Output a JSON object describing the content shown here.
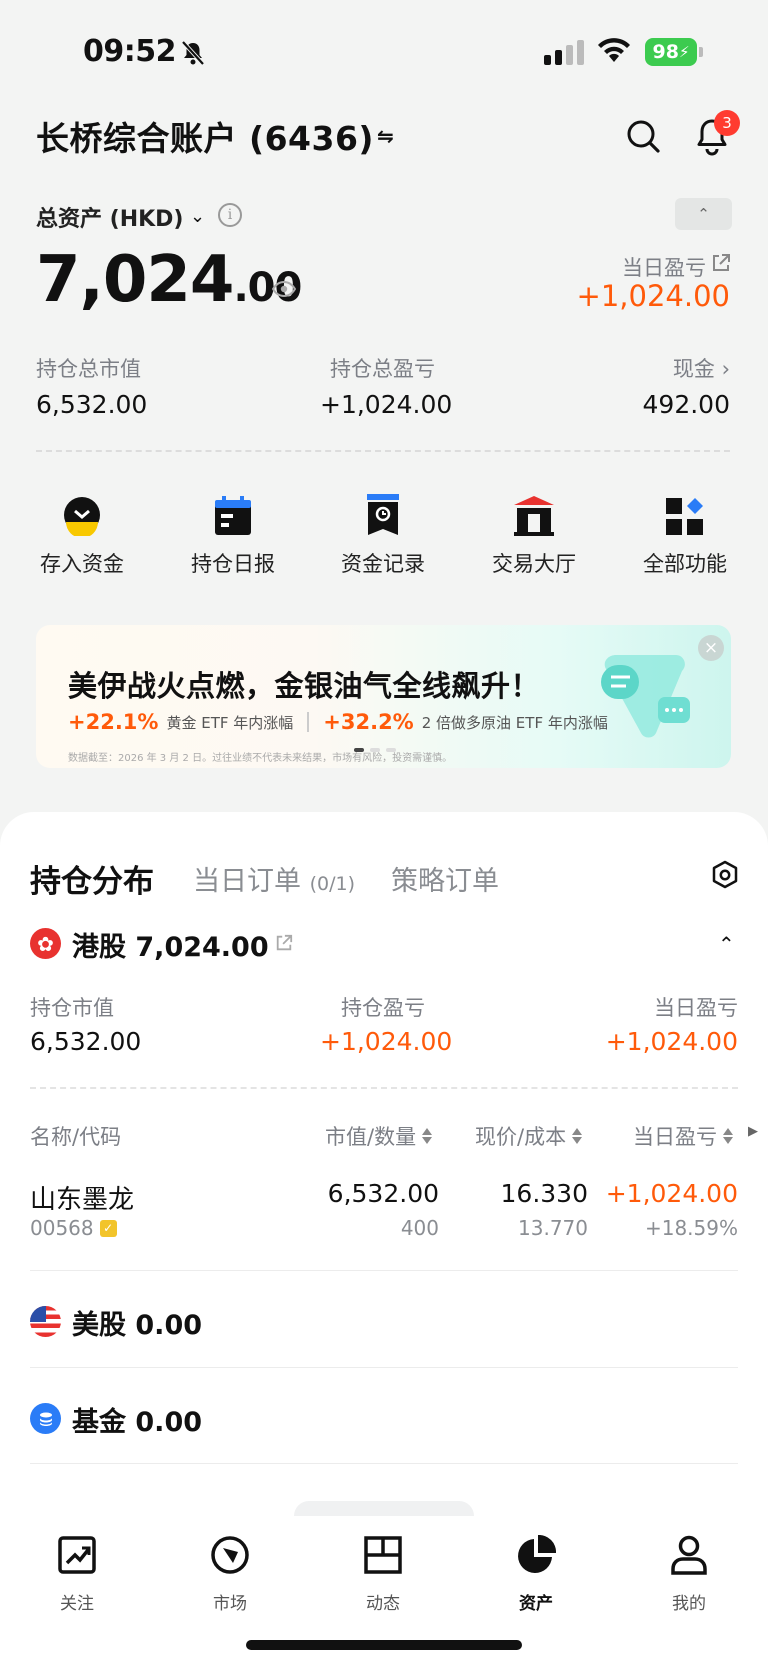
{
  "status_bar": {
    "time": "09:52",
    "battery": "98"
  },
  "header": {
    "account_title": "长桥综合账户 (6436)",
    "swap_symbol": "⇋",
    "notification_count": "3"
  },
  "summary": {
    "total_assets_label": "总资产 (HKD)",
    "total_assets_int": "7,024",
    "total_assets_dec": ".00",
    "day_pl_label": "当日盈亏",
    "day_pl_value": "+1,024.00",
    "market_value_label": "持仓总市值",
    "market_value": "6,532.00",
    "total_pl_label": "持仓总盈亏",
    "total_pl_value": "+1,024.00",
    "cash_label": "现金",
    "cash_value": "492.00"
  },
  "shortcuts": [
    {
      "label": "存入资金",
      "icon": "deposit-icon"
    },
    {
      "label": "持仓日报",
      "icon": "calendar-report-icon"
    },
    {
      "label": "资金记录",
      "icon": "fund-record-icon"
    },
    {
      "label": "交易大厅",
      "icon": "trading-hall-icon"
    },
    {
      "label": "全部功能",
      "icon": "all-features-icon"
    }
  ],
  "banner": {
    "title": "美伊战火点燃，金银油气全线飙升！",
    "stat1_value": "+22.1%",
    "stat1_label": "黄金 ETF 年内涨幅",
    "stat2_value": "+32.2%",
    "stat2_label": "2 倍做多原油 ETF 年内涨幅",
    "footnote": "数据截至：2026 年 3 月 2 日。过往业绩不代表未来结果，市场有风险，投资需谨慎。"
  },
  "tabs": {
    "positions": "持仓分布",
    "orders": "当日订单",
    "orders_count": "(0/1)",
    "strategy": "策略订单"
  },
  "hk": {
    "title": "港股 7,024.00",
    "mv_label": "持仓市值",
    "mv_value": "6,532.00",
    "pl_label": "持仓盈亏",
    "pl_value": "+1,024.00",
    "day_label": "当日盈亏",
    "day_value": "+1,024.00"
  },
  "table": {
    "headers": [
      "名称/代码",
      "市值/数量",
      "现价/成本",
      "当日盈亏"
    ],
    "rows": [
      {
        "name": "山东墨龙",
        "code": "00568",
        "market_value": "6,532.00",
        "quantity": "400",
        "price": "16.330",
        "cost": "13.770",
        "day_pl": "+1,024.00",
        "day_pl_pct": "+18.59%"
      }
    ]
  },
  "us": {
    "title": "美股 0.00"
  },
  "fund": {
    "title": "基金 0.00"
  },
  "tabbar": [
    {
      "label": "关注",
      "icon": "watchlist-icon"
    },
    {
      "label": "市场",
      "icon": "market-icon"
    },
    {
      "label": "动态",
      "icon": "feed-icon"
    },
    {
      "label": "资产",
      "icon": "assets-icon",
      "active": true
    },
    {
      "label": "我的",
      "icon": "profile-icon"
    }
  ],
  "colors": {
    "up": "#ff5a0a",
    "badge": "#ff3b30",
    "battery": "#3ccb4f"
  }
}
